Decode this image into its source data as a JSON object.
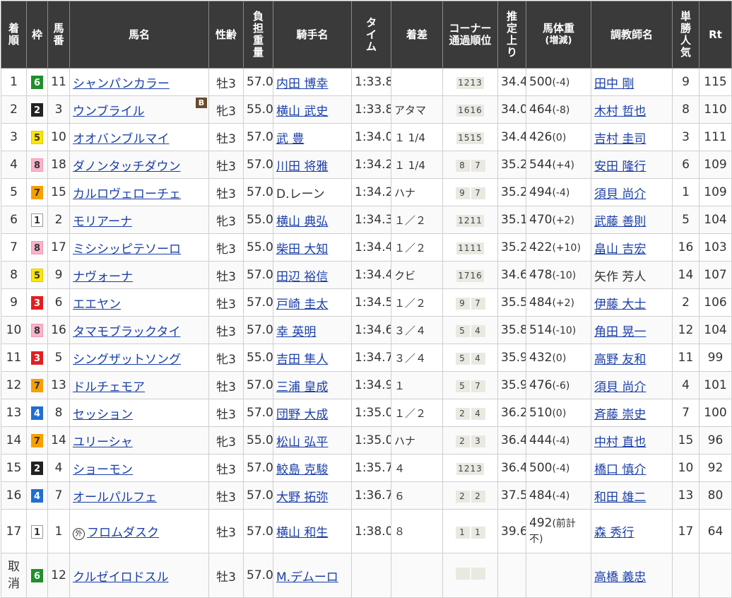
{
  "headers": {
    "rank": "着順",
    "waku": "枠",
    "umaban": "馬番",
    "name": "馬名",
    "sex_age": "性齢",
    "weight": "負担重量",
    "jockey": "騎手名",
    "time": "タイム",
    "margin": "着差",
    "corner": "コーナー通過順位",
    "last3f": "推定上り",
    "body_weight": "馬体重",
    "body_weight_sub": "(増減)",
    "trainer": "調教師名",
    "popularity": "単勝人気",
    "rt": "Rt"
  },
  "rows": [
    {
      "rank": "1",
      "waku": "6",
      "umaban": "11",
      "name": "シャンパンカラー",
      "sex": "牡3",
      "wt": "57.0",
      "jockey": "内田 博幸",
      "time": "1:33.8",
      "margin": "",
      "c1": "1213",
      "c2": "",
      "l3f": "34.4",
      "bw": "500",
      "bwd": "(-4)",
      "trainer": "田中 剛",
      "pop": "9",
      "rt": "115"
    },
    {
      "rank": "2",
      "waku": "2",
      "umaban": "3",
      "name": "ウンブライル",
      "badge": "B",
      "sex": "牝3",
      "wt": "55.0",
      "jockey": "横山 武史",
      "time": "1:33.8",
      "margin": "アタマ",
      "c1": "1616",
      "c2": "",
      "l3f": "34.0",
      "bw": "464",
      "bwd": "(-8)",
      "trainer": "木村 哲也",
      "pop": "8",
      "rt": "110"
    },
    {
      "rank": "3",
      "waku": "5",
      "umaban": "10",
      "name": "オオバンブルマイ",
      "sex": "牡3",
      "wt": "57.0",
      "jockey": "武 豊",
      "time": "1:34.0",
      "margin": "１ 1/4",
      "c1": "1515",
      "c2": "",
      "l3f": "34.4",
      "bw": "426",
      "bwd": "(0)",
      "trainer": "吉村 圭司",
      "pop": "3",
      "rt": "111"
    },
    {
      "rank": "4",
      "waku": "8",
      "umaban": "18",
      "name": "ダノンタッチダウン",
      "sex": "牡3",
      "wt": "57.0",
      "jockey": "川田 将雅",
      "time": "1:34.2",
      "margin": "１ 1/4",
      "c1": "8",
      "c2": "7",
      "l3f": "35.2",
      "bw": "544",
      "bwd": "(+4)",
      "trainer": "安田 隆行",
      "pop": "6",
      "rt": "109"
    },
    {
      "rank": "5",
      "waku": "7",
      "umaban": "15",
      "name": "カルロヴェローチェ",
      "sex": "牡3",
      "wt": "57.0",
      "jockey": "D.レーン",
      "jockey_plain": true,
      "time": "1:34.2",
      "margin": "ハナ",
      "c1": "9",
      "c2": "7",
      "l3f": "35.2",
      "bw": "494",
      "bwd": "(-4)",
      "trainer": "須貝 尚介",
      "pop": "1",
      "rt": "109"
    },
    {
      "rank": "6",
      "waku": "1",
      "umaban": "2",
      "name": "モリアーナ",
      "sex": "牝3",
      "wt": "55.0",
      "jockey": "横山 典弘",
      "time": "1:34.3",
      "margin": "１／２",
      "c1": "1211",
      "c2": "",
      "l3f": "35.1",
      "bw": "470",
      "bwd": "(+2)",
      "trainer": "武藤 善則",
      "pop": "5",
      "rt": "104"
    },
    {
      "rank": "7",
      "waku": "8",
      "umaban": "17",
      "name": "ミシシッピテソーロ",
      "sex": "牝3",
      "wt": "55.0",
      "jockey": "柴田 大知",
      "time": "1:34.4",
      "margin": "１／２",
      "c1": "1111",
      "c2": "",
      "l3f": "35.2",
      "bw": "422",
      "bwd": "(+10)",
      "trainer": "畠山 吉宏",
      "pop": "16",
      "rt": "103"
    },
    {
      "rank": "8",
      "waku": "5",
      "umaban": "9",
      "name": "ナヴォーナ",
      "sex": "牡3",
      "wt": "57.0",
      "jockey": "田辺 裕信",
      "time": "1:34.4",
      "margin": "クビ",
      "c1": "1716",
      "c2": "",
      "l3f": "34.6",
      "bw": "478",
      "bwd": "(-10)",
      "trainer": "矢作 芳人",
      "trainer_plain": true,
      "pop": "14",
      "rt": "107"
    },
    {
      "rank": "9",
      "waku": "3",
      "umaban": "6",
      "name": "エエヤン",
      "sex": "牡3",
      "wt": "57.0",
      "jockey": "戸崎 圭太",
      "time": "1:34.5",
      "margin": "１／２",
      "c1": "9",
      "c2": "7",
      "l3f": "35.5",
      "bw": "484",
      "bwd": "(+2)",
      "trainer": "伊藤 大士",
      "pop": "2",
      "rt": "106"
    },
    {
      "rank": "10",
      "waku": "8",
      "umaban": "16",
      "name": "タマモブラックタイ",
      "sex": "牡3",
      "wt": "57.0",
      "jockey": "幸 英明",
      "time": "1:34.6",
      "margin": "３／４",
      "c1": "5",
      "c2": "4",
      "l3f": "35.8",
      "bw": "514",
      "bwd": "(-10)",
      "trainer": "角田 晃一",
      "pop": "12",
      "rt": "104"
    },
    {
      "rank": "11",
      "waku": "3",
      "umaban": "5",
      "name": "シングザットソング",
      "sex": "牝3",
      "wt": "55.0",
      "jockey": "吉田 隼人",
      "time": "1:34.7",
      "margin": "３／４",
      "c1": "5",
      "c2": "4",
      "l3f": "35.9",
      "bw": "432",
      "bwd": "(0)",
      "trainer": "高野 友和",
      "pop": "11",
      "rt": "99"
    },
    {
      "rank": "12",
      "waku": "7",
      "umaban": "13",
      "name": "ドルチェモア",
      "sex": "牡3",
      "wt": "57.0",
      "jockey": "三浦 皇成",
      "time": "1:34.9",
      "margin": "１",
      "c1": "5",
      "c2": "7",
      "l3f": "35.9",
      "bw": "476",
      "bwd": "(-6)",
      "trainer": "須貝 尚介",
      "pop": "4",
      "rt": "101"
    },
    {
      "rank": "13",
      "waku": "4",
      "umaban": "8",
      "name": "セッション",
      "sex": "牡3",
      "wt": "57.0",
      "jockey": "団野 大成",
      "time": "1:35.0",
      "margin": "１／２",
      "c1": "2",
      "c2": "4",
      "l3f": "36.2",
      "bw": "510",
      "bwd": "(0)",
      "trainer": "斉藤 崇史",
      "pop": "7",
      "rt": "100"
    },
    {
      "rank": "14",
      "waku": "7",
      "umaban": "14",
      "name": "ユリーシャ",
      "sex": "牝3",
      "wt": "55.0",
      "jockey": "松山 弘平",
      "time": "1:35.0",
      "margin": "ハナ",
      "c1": "2",
      "c2": "3",
      "l3f": "36.4",
      "bw": "444",
      "bwd": "(-4)",
      "trainer": "中村 直也",
      "pop": "15",
      "rt": "96"
    },
    {
      "rank": "15",
      "waku": "2",
      "umaban": "4",
      "name": "ショーモン",
      "sex": "牡3",
      "wt": "57.0",
      "jockey": "鮫島 克駿",
      "time": "1:35.7",
      "margin": "４",
      "c1": "1213",
      "c2": "",
      "l3f": "36.4",
      "bw": "500",
      "bwd": "(-4)",
      "trainer": "橋口 慎介",
      "pop": "10",
      "rt": "92"
    },
    {
      "rank": "16",
      "waku": "4",
      "umaban": "7",
      "name": "オールパルフェ",
      "sex": "牡3",
      "wt": "57.0",
      "jockey": "大野 拓弥",
      "time": "1:36.7",
      "margin": "６",
      "c1": "2",
      "c2": "2",
      "l3f": "37.5",
      "bw": "484",
      "bwd": "(-4)",
      "trainer": "和田 雄二",
      "pop": "13",
      "rt": "80"
    },
    {
      "rank": "17",
      "waku": "1",
      "umaban": "1",
      "name": "フロムダスク",
      "gai": "外",
      "sex": "牡3",
      "wt": "57.0",
      "jockey": "横山 和生",
      "time": "1:38.0",
      "margin": "８",
      "c1": "1",
      "c2": "1",
      "l3f": "39.6",
      "bw": "492",
      "bwd": "(前計不)",
      "trainer": "森 秀行",
      "pop": "17",
      "rt": "64",
      "tall": true
    },
    {
      "rank": "取消",
      "waku": "6",
      "umaban": "12",
      "name": "クルゼイロドスル",
      "sex": "牡3",
      "wt": "57.0",
      "jockey": "M.デムーロ",
      "time": "",
      "margin": "",
      "c1": "",
      "c2": "",
      "l3f": "",
      "bw": "",
      "bwd": "",
      "trainer": "高橋 義忠",
      "pop": "",
      "rt": "",
      "tall": true,
      "scratched": true
    }
  ]
}
